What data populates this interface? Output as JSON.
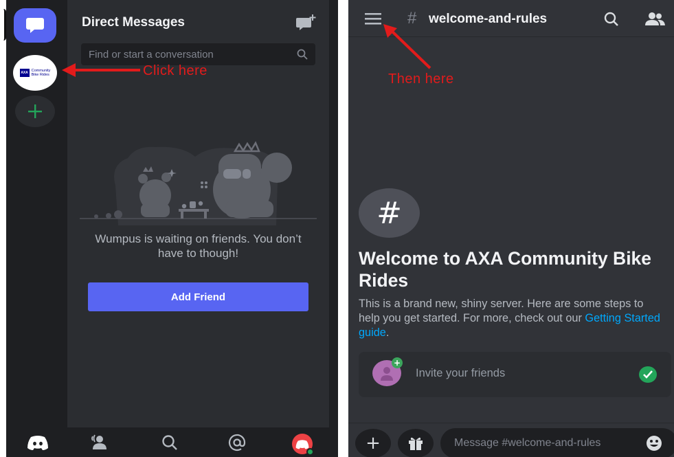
{
  "colors": {
    "blurple": "#5865f2",
    "annotation_red": "#e21b1b",
    "link_blue": "#00a8fc",
    "success_green": "#23a55a",
    "bg_primary": "#313338",
    "bg_secondary": "#2b2d31",
    "bg_tertiary": "#1e1f22"
  },
  "left_screen": {
    "server_rail": {
      "home_icon": "chat-bubble-icon",
      "server_icon": {
        "logo_mark": "AXA",
        "logo_text_line1": "Community",
        "logo_text_line2": "Bike Rides"
      },
      "add_server_icon": "plus-icon"
    },
    "dm_panel": {
      "title": "Direct Messages",
      "new_dm_icon": "new-message-icon",
      "search_placeholder": "Find or start a conversation",
      "empty_state_text": "Wumpus is waiting on friends. You don’t have to though!",
      "add_friend_label": "Add Friend"
    },
    "bottom_nav": [
      "discord-logo-icon",
      "friends-wave-icon",
      "search-icon",
      "mention-icon",
      "avatar"
    ],
    "annotation": "Click here"
  },
  "right_screen": {
    "header": {
      "menu_icon": "hamburger-menu-icon",
      "hash": "#",
      "channel_name": "welcome-and-rules",
      "search_icon": "search-icon",
      "members_icon": "members-icon"
    },
    "annotation": "Then here",
    "welcome": {
      "hash_symbol": "#",
      "title": "Welcome to AXA Community Bike Rides",
      "desc_prefix": "This is a brand new, shiny server. Here are some steps to help you get started. For more, check out our ",
      "desc_link": "Getting Started guide",
      "desc_suffix": ".",
      "invite_label": "Invite your friends",
      "invite_done": true
    },
    "composer": {
      "placeholder": "Message #welcome-and-rules",
      "plus_label": "+"
    }
  }
}
